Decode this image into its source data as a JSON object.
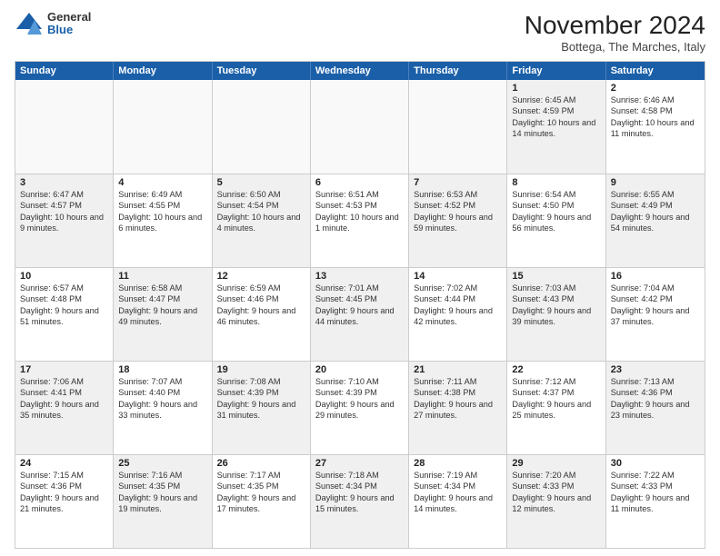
{
  "logo": {
    "general": "General",
    "blue": "Blue"
  },
  "title": "November 2024",
  "location": "Bottega, The Marches, Italy",
  "days": [
    "Sunday",
    "Monday",
    "Tuesday",
    "Wednesday",
    "Thursday",
    "Friday",
    "Saturday"
  ],
  "rows": [
    [
      {
        "day": "",
        "text": "",
        "empty": true
      },
      {
        "day": "",
        "text": "",
        "empty": true
      },
      {
        "day": "",
        "text": "",
        "empty": true
      },
      {
        "day": "",
        "text": "",
        "empty": true
      },
      {
        "day": "",
        "text": "",
        "empty": true
      },
      {
        "day": "1",
        "text": "Sunrise: 6:45 AM\nSunset: 4:59 PM\nDaylight: 10 hours and 14 minutes.",
        "shaded": true
      },
      {
        "day": "2",
        "text": "Sunrise: 6:46 AM\nSunset: 4:58 PM\nDaylight: 10 hours and 11 minutes.",
        "shaded": false
      }
    ],
    [
      {
        "day": "3",
        "text": "Sunrise: 6:47 AM\nSunset: 4:57 PM\nDaylight: 10 hours and 9 minutes.",
        "shaded": true
      },
      {
        "day": "4",
        "text": "Sunrise: 6:49 AM\nSunset: 4:55 PM\nDaylight: 10 hours and 6 minutes.",
        "shaded": false
      },
      {
        "day": "5",
        "text": "Sunrise: 6:50 AM\nSunset: 4:54 PM\nDaylight: 10 hours and 4 minutes.",
        "shaded": true
      },
      {
        "day": "6",
        "text": "Sunrise: 6:51 AM\nSunset: 4:53 PM\nDaylight: 10 hours and 1 minute.",
        "shaded": false
      },
      {
        "day": "7",
        "text": "Sunrise: 6:53 AM\nSunset: 4:52 PM\nDaylight: 9 hours and 59 minutes.",
        "shaded": true
      },
      {
        "day": "8",
        "text": "Sunrise: 6:54 AM\nSunset: 4:50 PM\nDaylight: 9 hours and 56 minutes.",
        "shaded": false
      },
      {
        "day": "9",
        "text": "Sunrise: 6:55 AM\nSunset: 4:49 PM\nDaylight: 9 hours and 54 minutes.",
        "shaded": true
      }
    ],
    [
      {
        "day": "10",
        "text": "Sunrise: 6:57 AM\nSunset: 4:48 PM\nDaylight: 9 hours and 51 minutes.",
        "shaded": false
      },
      {
        "day": "11",
        "text": "Sunrise: 6:58 AM\nSunset: 4:47 PM\nDaylight: 9 hours and 49 minutes.",
        "shaded": true
      },
      {
        "day": "12",
        "text": "Sunrise: 6:59 AM\nSunset: 4:46 PM\nDaylight: 9 hours and 46 minutes.",
        "shaded": false
      },
      {
        "day": "13",
        "text": "Sunrise: 7:01 AM\nSunset: 4:45 PM\nDaylight: 9 hours and 44 minutes.",
        "shaded": true
      },
      {
        "day": "14",
        "text": "Sunrise: 7:02 AM\nSunset: 4:44 PM\nDaylight: 9 hours and 42 minutes.",
        "shaded": false
      },
      {
        "day": "15",
        "text": "Sunrise: 7:03 AM\nSunset: 4:43 PM\nDaylight: 9 hours and 39 minutes.",
        "shaded": true
      },
      {
        "day": "16",
        "text": "Sunrise: 7:04 AM\nSunset: 4:42 PM\nDaylight: 9 hours and 37 minutes.",
        "shaded": false
      }
    ],
    [
      {
        "day": "17",
        "text": "Sunrise: 7:06 AM\nSunset: 4:41 PM\nDaylight: 9 hours and 35 minutes.",
        "shaded": true
      },
      {
        "day": "18",
        "text": "Sunrise: 7:07 AM\nSunset: 4:40 PM\nDaylight: 9 hours and 33 minutes.",
        "shaded": false
      },
      {
        "day": "19",
        "text": "Sunrise: 7:08 AM\nSunset: 4:39 PM\nDaylight: 9 hours and 31 minutes.",
        "shaded": true
      },
      {
        "day": "20",
        "text": "Sunrise: 7:10 AM\nSunset: 4:39 PM\nDaylight: 9 hours and 29 minutes.",
        "shaded": false
      },
      {
        "day": "21",
        "text": "Sunrise: 7:11 AM\nSunset: 4:38 PM\nDaylight: 9 hours and 27 minutes.",
        "shaded": true
      },
      {
        "day": "22",
        "text": "Sunrise: 7:12 AM\nSunset: 4:37 PM\nDaylight: 9 hours and 25 minutes.",
        "shaded": false
      },
      {
        "day": "23",
        "text": "Sunrise: 7:13 AM\nSunset: 4:36 PM\nDaylight: 9 hours and 23 minutes.",
        "shaded": true
      }
    ],
    [
      {
        "day": "24",
        "text": "Sunrise: 7:15 AM\nSunset: 4:36 PM\nDaylight: 9 hours and 21 minutes.",
        "shaded": false
      },
      {
        "day": "25",
        "text": "Sunrise: 7:16 AM\nSunset: 4:35 PM\nDaylight: 9 hours and 19 minutes.",
        "shaded": true
      },
      {
        "day": "26",
        "text": "Sunrise: 7:17 AM\nSunset: 4:35 PM\nDaylight: 9 hours and 17 minutes.",
        "shaded": false
      },
      {
        "day": "27",
        "text": "Sunrise: 7:18 AM\nSunset: 4:34 PM\nDaylight: 9 hours and 15 minutes.",
        "shaded": true
      },
      {
        "day": "28",
        "text": "Sunrise: 7:19 AM\nSunset: 4:34 PM\nDaylight: 9 hours and 14 minutes.",
        "shaded": false
      },
      {
        "day": "29",
        "text": "Sunrise: 7:20 AM\nSunset: 4:33 PM\nDaylight: 9 hours and 12 minutes.",
        "shaded": true
      },
      {
        "day": "30",
        "text": "Sunrise: 7:22 AM\nSunset: 4:33 PM\nDaylight: 9 hours and 11 minutes.",
        "shaded": false
      }
    ]
  ]
}
